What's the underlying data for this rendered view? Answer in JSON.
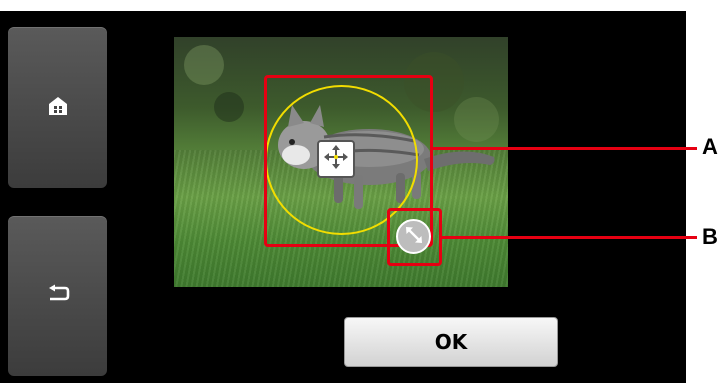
{
  "screen": {
    "home_button": {
      "icon": "home-icon"
    },
    "back_button": {
      "icon": "back-arrow-icon"
    },
    "ok_label": "OK",
    "move_handle_icon": "move-arrows-icon",
    "resize_handle_icon": "resize-arrow-icon"
  },
  "callouts": {
    "a": "A",
    "b": "B"
  },
  "colors": {
    "callout_red": "#e60012",
    "crop_circle_yellow": "#f2dd00",
    "screen_background": "#000000",
    "side_button_gray": "#4a4a4a"
  }
}
